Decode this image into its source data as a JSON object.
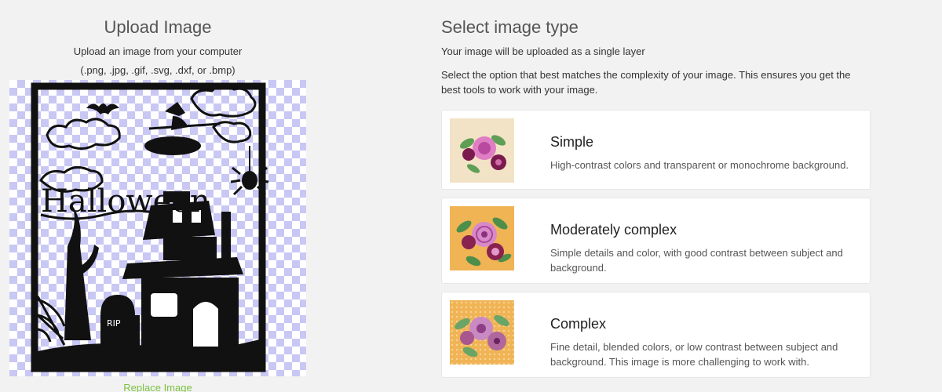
{
  "upload": {
    "title": "Upload Image",
    "subtitle": "Upload an image from your computer",
    "formats": "(.png, .jpg, .gif, .svg, .dxf, or .bmp)",
    "replace_label": "Replace Image",
    "preview_text": "Halloween",
    "tombstone_text": "RIP"
  },
  "image_type": {
    "title": "Select image type",
    "subtitle": "Your image will be uploaded as a single layer",
    "description": "Select the option that best matches the complexity of your image. This ensures you get the best tools to work with your image.",
    "options": [
      {
        "name": "Simple",
        "description": "High-contrast colors and transparent or monochrome background."
      },
      {
        "name": "Moderately complex",
        "description": "Simple details and color, with good contrast between subject and background."
      },
      {
        "name": "Complex",
        "description": "Fine detail, blended colors, or low contrast between subject and background. This image is more challenging to work with."
      }
    ]
  },
  "colors": {
    "background": "#f2f2f2",
    "link_green": "#7cc242",
    "checker": "#c9c7f3"
  }
}
